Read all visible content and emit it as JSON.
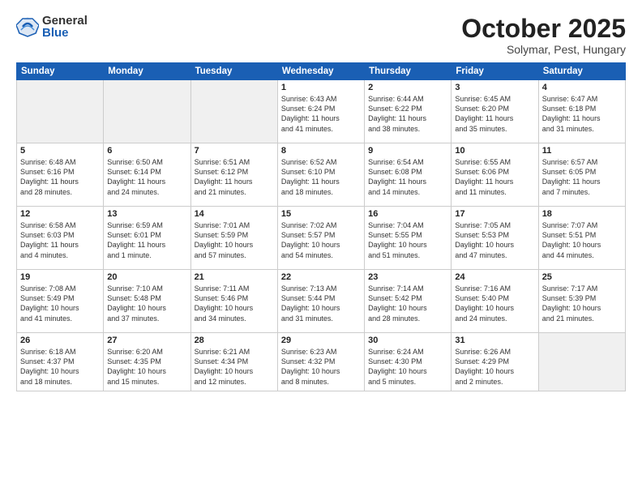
{
  "header": {
    "logo_general": "General",
    "logo_blue": "Blue",
    "month_title": "October 2025",
    "location": "Solymar, Pest, Hungary"
  },
  "weekdays": [
    "Sunday",
    "Monday",
    "Tuesday",
    "Wednesday",
    "Thursday",
    "Friday",
    "Saturday"
  ],
  "weeks": [
    [
      {
        "day": "",
        "text": ""
      },
      {
        "day": "",
        "text": ""
      },
      {
        "day": "",
        "text": ""
      },
      {
        "day": "1",
        "text": "Sunrise: 6:43 AM\nSunset: 6:24 PM\nDaylight: 11 hours\nand 41 minutes."
      },
      {
        "day": "2",
        "text": "Sunrise: 6:44 AM\nSunset: 6:22 PM\nDaylight: 11 hours\nand 38 minutes."
      },
      {
        "day": "3",
        "text": "Sunrise: 6:45 AM\nSunset: 6:20 PM\nDaylight: 11 hours\nand 35 minutes."
      },
      {
        "day": "4",
        "text": "Sunrise: 6:47 AM\nSunset: 6:18 PM\nDaylight: 11 hours\nand 31 minutes."
      }
    ],
    [
      {
        "day": "5",
        "text": "Sunrise: 6:48 AM\nSunset: 6:16 PM\nDaylight: 11 hours\nand 28 minutes."
      },
      {
        "day": "6",
        "text": "Sunrise: 6:50 AM\nSunset: 6:14 PM\nDaylight: 11 hours\nand 24 minutes."
      },
      {
        "day": "7",
        "text": "Sunrise: 6:51 AM\nSunset: 6:12 PM\nDaylight: 11 hours\nand 21 minutes."
      },
      {
        "day": "8",
        "text": "Sunrise: 6:52 AM\nSunset: 6:10 PM\nDaylight: 11 hours\nand 18 minutes."
      },
      {
        "day": "9",
        "text": "Sunrise: 6:54 AM\nSunset: 6:08 PM\nDaylight: 11 hours\nand 14 minutes."
      },
      {
        "day": "10",
        "text": "Sunrise: 6:55 AM\nSunset: 6:06 PM\nDaylight: 11 hours\nand 11 minutes."
      },
      {
        "day": "11",
        "text": "Sunrise: 6:57 AM\nSunset: 6:05 PM\nDaylight: 11 hours\nand 7 minutes."
      }
    ],
    [
      {
        "day": "12",
        "text": "Sunrise: 6:58 AM\nSunset: 6:03 PM\nDaylight: 11 hours\nand 4 minutes."
      },
      {
        "day": "13",
        "text": "Sunrise: 6:59 AM\nSunset: 6:01 PM\nDaylight: 11 hours\nand 1 minute."
      },
      {
        "day": "14",
        "text": "Sunrise: 7:01 AM\nSunset: 5:59 PM\nDaylight: 10 hours\nand 57 minutes."
      },
      {
        "day": "15",
        "text": "Sunrise: 7:02 AM\nSunset: 5:57 PM\nDaylight: 10 hours\nand 54 minutes."
      },
      {
        "day": "16",
        "text": "Sunrise: 7:04 AM\nSunset: 5:55 PM\nDaylight: 10 hours\nand 51 minutes."
      },
      {
        "day": "17",
        "text": "Sunrise: 7:05 AM\nSunset: 5:53 PM\nDaylight: 10 hours\nand 47 minutes."
      },
      {
        "day": "18",
        "text": "Sunrise: 7:07 AM\nSunset: 5:51 PM\nDaylight: 10 hours\nand 44 minutes."
      }
    ],
    [
      {
        "day": "19",
        "text": "Sunrise: 7:08 AM\nSunset: 5:49 PM\nDaylight: 10 hours\nand 41 minutes."
      },
      {
        "day": "20",
        "text": "Sunrise: 7:10 AM\nSunset: 5:48 PM\nDaylight: 10 hours\nand 37 minutes."
      },
      {
        "day": "21",
        "text": "Sunrise: 7:11 AM\nSunset: 5:46 PM\nDaylight: 10 hours\nand 34 minutes."
      },
      {
        "day": "22",
        "text": "Sunrise: 7:13 AM\nSunset: 5:44 PM\nDaylight: 10 hours\nand 31 minutes."
      },
      {
        "day": "23",
        "text": "Sunrise: 7:14 AM\nSunset: 5:42 PM\nDaylight: 10 hours\nand 28 minutes."
      },
      {
        "day": "24",
        "text": "Sunrise: 7:16 AM\nSunset: 5:40 PM\nDaylight: 10 hours\nand 24 minutes."
      },
      {
        "day": "25",
        "text": "Sunrise: 7:17 AM\nSunset: 5:39 PM\nDaylight: 10 hours\nand 21 minutes."
      }
    ],
    [
      {
        "day": "26",
        "text": "Sunrise: 6:18 AM\nSunset: 4:37 PM\nDaylight: 10 hours\nand 18 minutes."
      },
      {
        "day": "27",
        "text": "Sunrise: 6:20 AM\nSunset: 4:35 PM\nDaylight: 10 hours\nand 15 minutes."
      },
      {
        "day": "28",
        "text": "Sunrise: 6:21 AM\nSunset: 4:34 PM\nDaylight: 10 hours\nand 12 minutes."
      },
      {
        "day": "29",
        "text": "Sunrise: 6:23 AM\nSunset: 4:32 PM\nDaylight: 10 hours\nand 8 minutes."
      },
      {
        "day": "30",
        "text": "Sunrise: 6:24 AM\nSunset: 4:30 PM\nDaylight: 10 hours\nand 5 minutes."
      },
      {
        "day": "31",
        "text": "Sunrise: 6:26 AM\nSunset: 4:29 PM\nDaylight: 10 hours\nand 2 minutes."
      },
      {
        "day": "",
        "text": ""
      }
    ]
  ]
}
